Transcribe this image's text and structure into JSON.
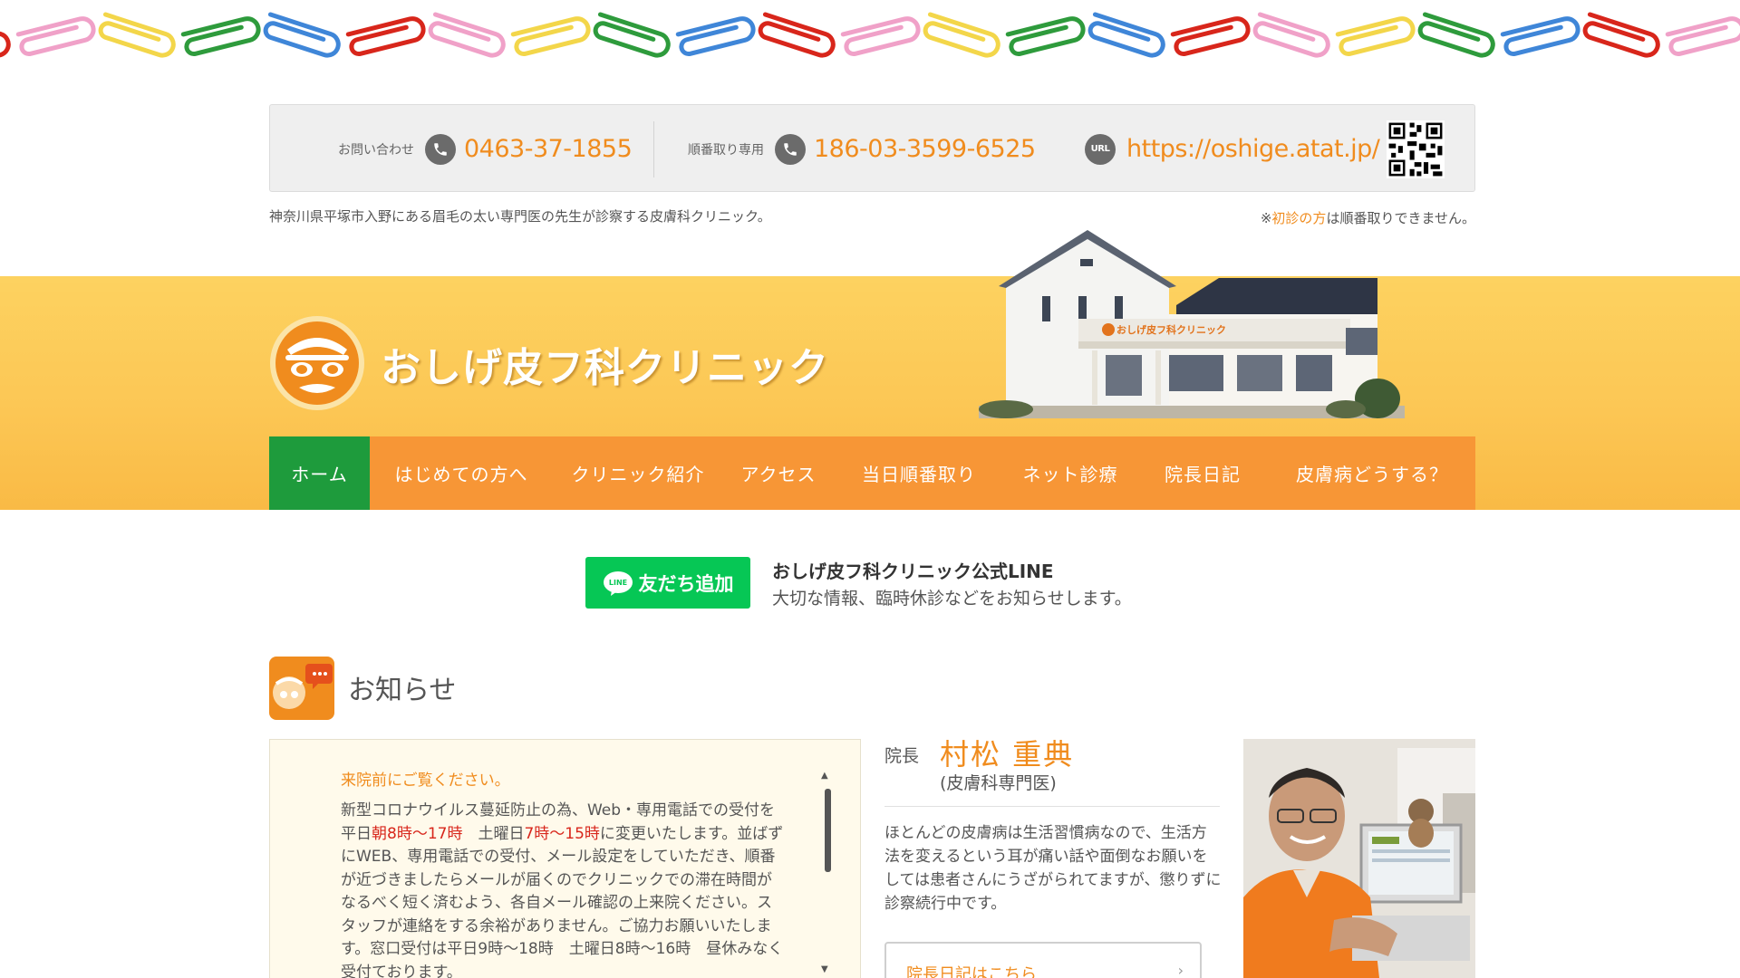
{
  "contact": {
    "inquiry_label": "お問い合わせ",
    "inquiry_phone": "0463-37-1855",
    "queue_label": "順番取り専用",
    "queue_phone": "186-03-3599-6525",
    "url_icon_text": "URL",
    "url": "https://oshige.atat.jp/"
  },
  "tagline": "神奈川県平塚市入野にある眉毛の太い専門医の先生が診察する皮膚科クリニック。",
  "first_visit_notice": {
    "prefix": "※",
    "highlight": "初診の方",
    "suffix": "は順番取りできません。"
  },
  "brand": {
    "name": "おしげ皮フ科クリニック",
    "building_sign": "おしげ皮フ科クリニック"
  },
  "nav": {
    "items": [
      {
        "label": "ホーム",
        "active": true
      },
      {
        "label": "はじめての方へ",
        "active": false
      },
      {
        "label": "クリニック紹介",
        "active": false
      },
      {
        "label": "アクセス",
        "active": false
      },
      {
        "label": "当日順番取り",
        "active": false
      },
      {
        "label": "ネット診療",
        "active": false
      },
      {
        "label": "院長日記",
        "active": false
      },
      {
        "label": "皮膚病どうする？",
        "active": false
      }
    ]
  },
  "line": {
    "button_label": "友だち追加",
    "icon_text": "LINE",
    "title": "おしげ皮フ科クリニック公式LINE",
    "description": "大切な情報、臨時休診などをお知らせします。"
  },
  "news": {
    "title": "お知らせ",
    "notice_heading": "来院前にご覧ください。",
    "body": {
      "line1": "新型コロナウイルス蔓延防止の為、Web・専用電話での受付を",
      "line2_a": "平日",
      "line2_b": "朝8時〜17時",
      "line2_c": "　土曜日",
      "line2_d": "7時〜15時",
      "line2_e": "に変更いたします。並ばず",
      "line3": "にWEB、専用電話での受付、メール設定をしていただき、順番",
      "line4": "が近づきましたらメールが届くのでクリニックでの滞在時間が",
      "line5": "なるべく短く済むよう、各自メール確認の上来院ください。ス",
      "line6": "タッフが連絡をする余裕がありません。ご協力お願いいたしま",
      "line7": "す。窓口受付は平日9時〜18時　土曜日8時〜16時　昼休みなく",
      "line8": "受付ております。"
    }
  },
  "director": {
    "label": "院長",
    "name": "村松 重典",
    "title": "(皮膚科専門医)",
    "description": "ほとんどの皮膚病は生活習慣病なので、生活方法を変えるという耳が痛い話や面倒なお願いをしては患者さんにうざがられてますが、懲りずに診察続行中です。",
    "diary_button": "院長日記はこちら",
    "diary_arrow": "›"
  },
  "colors": {
    "accent_orange": "#f08c1e",
    "nav_orange": "#f79636",
    "nav_active_green": "#1e9b3c",
    "line_green": "#06c755",
    "banner_yellow": "#fcc755",
    "alert_red": "#d8261b"
  }
}
